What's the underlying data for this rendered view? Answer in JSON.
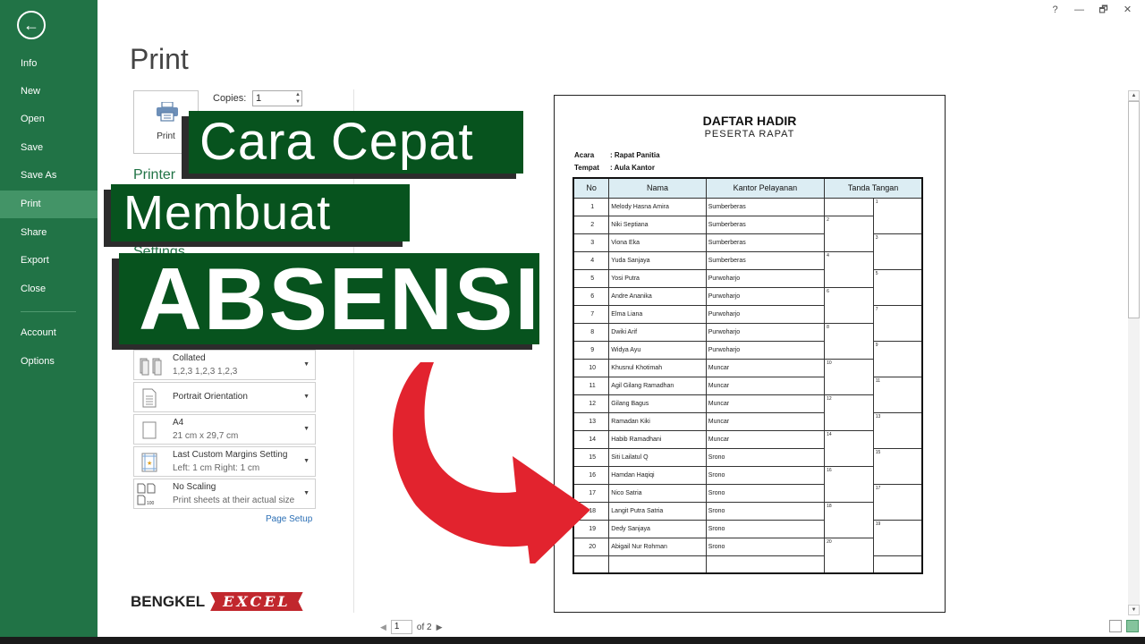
{
  "window": {
    "controls": {
      "help": "?",
      "minimize": "—",
      "restore": "🗗",
      "close": "✕"
    }
  },
  "sidebar": {
    "back_icon": "←",
    "items": [
      {
        "label": "Info",
        "active": false
      },
      {
        "label": "New",
        "active": false
      },
      {
        "label": "Open",
        "active": false
      },
      {
        "label": "Save",
        "active": false
      },
      {
        "label": "Save As",
        "active": false
      },
      {
        "label": "Print",
        "active": true
      },
      {
        "label": "Share",
        "active": false
      },
      {
        "label": "Export",
        "active": false
      },
      {
        "label": "Close",
        "active": false
      },
      {
        "label": "Account",
        "active": false
      },
      {
        "label": "Options",
        "active": false
      }
    ]
  },
  "print_panel": {
    "title": "Print",
    "print_button_label": "Print",
    "copies_label": "Copies:",
    "copies_value": "1",
    "printer_heading": "Printer",
    "settings_heading": "Settings",
    "settings": [
      {
        "icon": "collate-icon",
        "line1": "Collated",
        "line2": "1,2,3    1,2,3    1,2,3"
      },
      {
        "icon": "portrait-orientation-icon",
        "line1": "Portrait Orientation",
        "line2": ""
      },
      {
        "icon": "paper-size-icon",
        "line1": "A4",
        "line2": "21 cm x 29,7 cm"
      },
      {
        "icon": "margins-icon",
        "line1": "Last Custom Margins Setting",
        "line2": "Left:  1 cm    Right:  1 cm"
      },
      {
        "icon": "scaling-icon",
        "line1": "No Scaling",
        "line2": "Print sheets at their actual size"
      }
    ],
    "page_setup_link": "Page Setup"
  },
  "overlay": {
    "line1": "Cara Cepat",
    "line2": "Membuat",
    "line3": "ABSENSI",
    "banner_color": "#07531e",
    "arrow_color": "#e2232e"
  },
  "preview": {
    "doc_title": "DAFTAR HADIR",
    "doc_subtitle": "PESERTA RAPAT",
    "meta": [
      {
        "key": "Acara",
        "value": ": Rapat Panitia"
      },
      {
        "key": "Tempat",
        "value": ": Aula Kantor"
      }
    ],
    "columns": [
      "No",
      "Nama",
      "Kantor Pelayanan",
      "Tanda Tangan"
    ],
    "rows": [
      {
        "no": "1",
        "nama": "Melody Hasna Amira",
        "kantor": "Sumberberas"
      },
      {
        "no": "2",
        "nama": "Niki Septiana",
        "kantor": "Sumberberas"
      },
      {
        "no": "3",
        "nama": "Viona Eka",
        "kantor": "Sumberberas"
      },
      {
        "no": "4",
        "nama": "Yuda Sanjaya",
        "kantor": "Sumberberas"
      },
      {
        "no": "5",
        "nama": "Yosi Putra",
        "kantor": "Purwoharjo"
      },
      {
        "no": "6",
        "nama": "Andre Ananika",
        "kantor": "Purwoharjo"
      },
      {
        "no": "7",
        "nama": "Elma Liana",
        "kantor": "Purwoharjo"
      },
      {
        "no": "8",
        "nama": "Dwiki Arif",
        "kantor": "Purwoharjo"
      },
      {
        "no": "9",
        "nama": "Widya Ayu",
        "kantor": "Purwoharjo"
      },
      {
        "no": "10",
        "nama": "Khusnul Khotimah",
        "kantor": "Muncar"
      },
      {
        "no": "11",
        "nama": "Agil Gilang Ramadhan",
        "kantor": "Muncar"
      },
      {
        "no": "12",
        "nama": "Gilang Bagus",
        "kantor": "Muncar"
      },
      {
        "no": "13",
        "nama": "Ramadan Kiki",
        "kantor": "Muncar"
      },
      {
        "no": "14",
        "nama": "Habib Ramadhani",
        "kantor": "Muncar"
      },
      {
        "no": "15",
        "nama": "Siti Lailatul Q",
        "kantor": "Srono"
      },
      {
        "no": "16",
        "nama": "Hamdan Haqiqi",
        "kantor": "Srono"
      },
      {
        "no": "17",
        "nama": "Nico Satria",
        "kantor": "Srono"
      },
      {
        "no": "18",
        "nama": "Langit Putra Satria",
        "kantor": "Srono"
      },
      {
        "no": "19",
        "nama": "Dedy Sanjaya",
        "kantor": "Srono"
      },
      {
        "no": "20",
        "nama": "Abigail Nur Rohman",
        "kantor": "Srono"
      }
    ],
    "page_current": "1",
    "page_total_label": "of 2"
  },
  "branding": {
    "left": "BENGKEL",
    "right": "EXCEL"
  }
}
